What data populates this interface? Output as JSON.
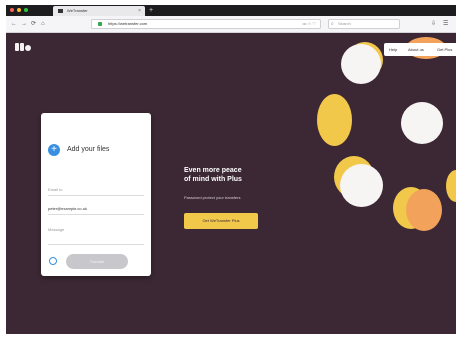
{
  "browser": {
    "tab_title": "WeTransfer",
    "tab_close": "×",
    "new_tab": "+",
    "url": "https://wetransfer.com",
    "url_icons": "••• ☆ ♡",
    "search_placeholder": "Search",
    "nav_back": "←",
    "nav_forward": "→",
    "nav_reload": "⟳",
    "nav_home": "⌂",
    "toolbar_icons": [
      "⇩",
      "☰"
    ]
  },
  "header": {
    "nav_items": [
      "Help",
      "About us",
      "Get Plus"
    ]
  },
  "upload_card": {
    "add_icon": "+",
    "title": "Add your files",
    "to_label": "Email to",
    "your_email": "peter@example.co.uk",
    "message_label": "Message",
    "transfer_button": "Transfer"
  },
  "promo": {
    "title_line1": "Even more peace",
    "title_line2": "of mind with Plus",
    "subtitle": "Password protect your transfers",
    "button": "Get WeTransfer Plus"
  },
  "colors": {
    "background": "#3b2834",
    "accent_yellow": "#f2c84b",
    "accent_blue": "#3b8fe0",
    "accent_orange": "#f2a25a",
    "circle_white": "#f7f4f4"
  }
}
